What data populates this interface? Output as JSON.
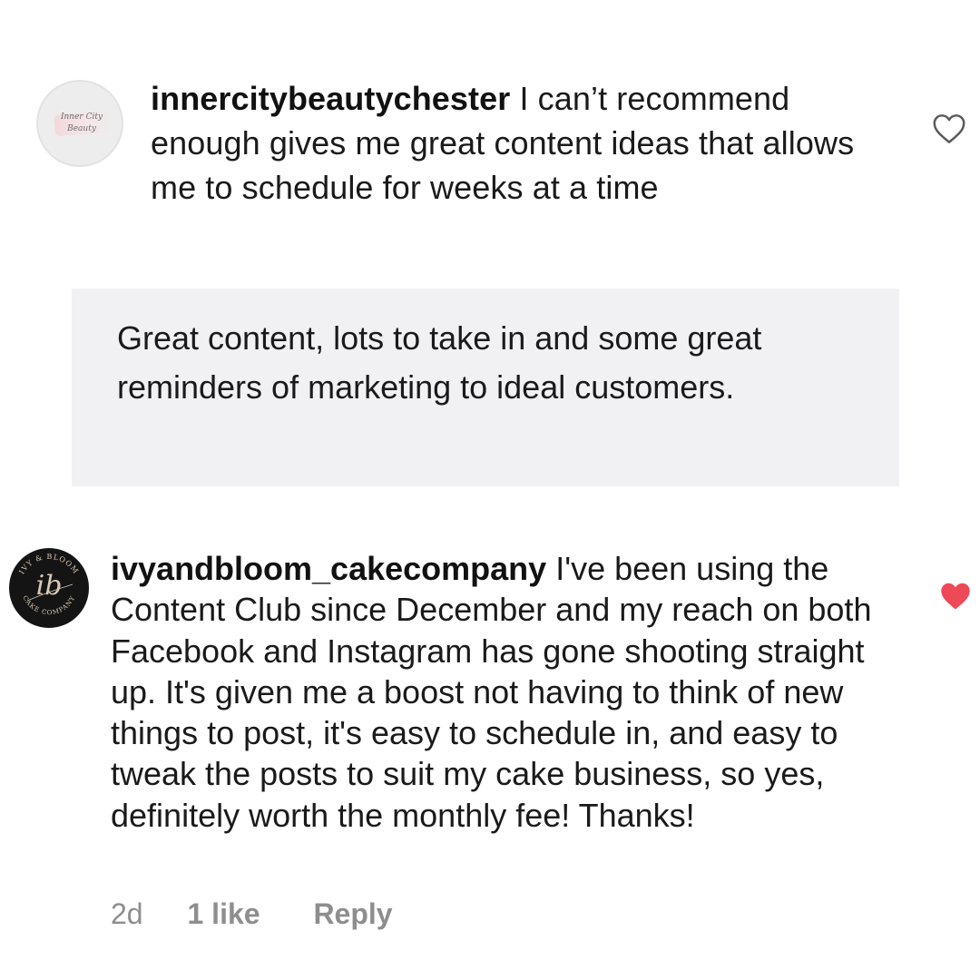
{
  "comments": [
    {
      "username": "innercitybeautychester",
      "text": " I can’t recommend enough gives me great content ideas that allows me to schedule for weeks at a time",
      "avatar": {
        "logo_line1": "Inner City",
        "logo_line2": "Beauty"
      },
      "like_icon": "heart-outline-icon",
      "liked": false
    },
    {
      "username": "ivyandbloom_cakecompany",
      "text": " I've been using the Content Club since December and my reach on both Facebook and Instagram has gone shooting straight up. It's given me a boost not having to think of new things to post, it's easy to schedule in, and easy to tweak the posts to suit my cake business, so yes, definitely worth the monthly fee! Thanks!",
      "avatar": {
        "monogram": "ib",
        "ring_text_top": "IVY & BLOOM",
        "ring_text_bottom": "CAKE COMPANY"
      },
      "like_icon": "heart-filled-icon",
      "liked": true,
      "like_color": "#ed4956",
      "meta": {
        "time": "2d",
        "likes": "1 like",
        "reply": "Reply"
      }
    }
  ],
  "review": {
    "text": "Great content, lots to take in and some great reminders of marketing to ideal customers.",
    "background": "#f1f1f4"
  }
}
